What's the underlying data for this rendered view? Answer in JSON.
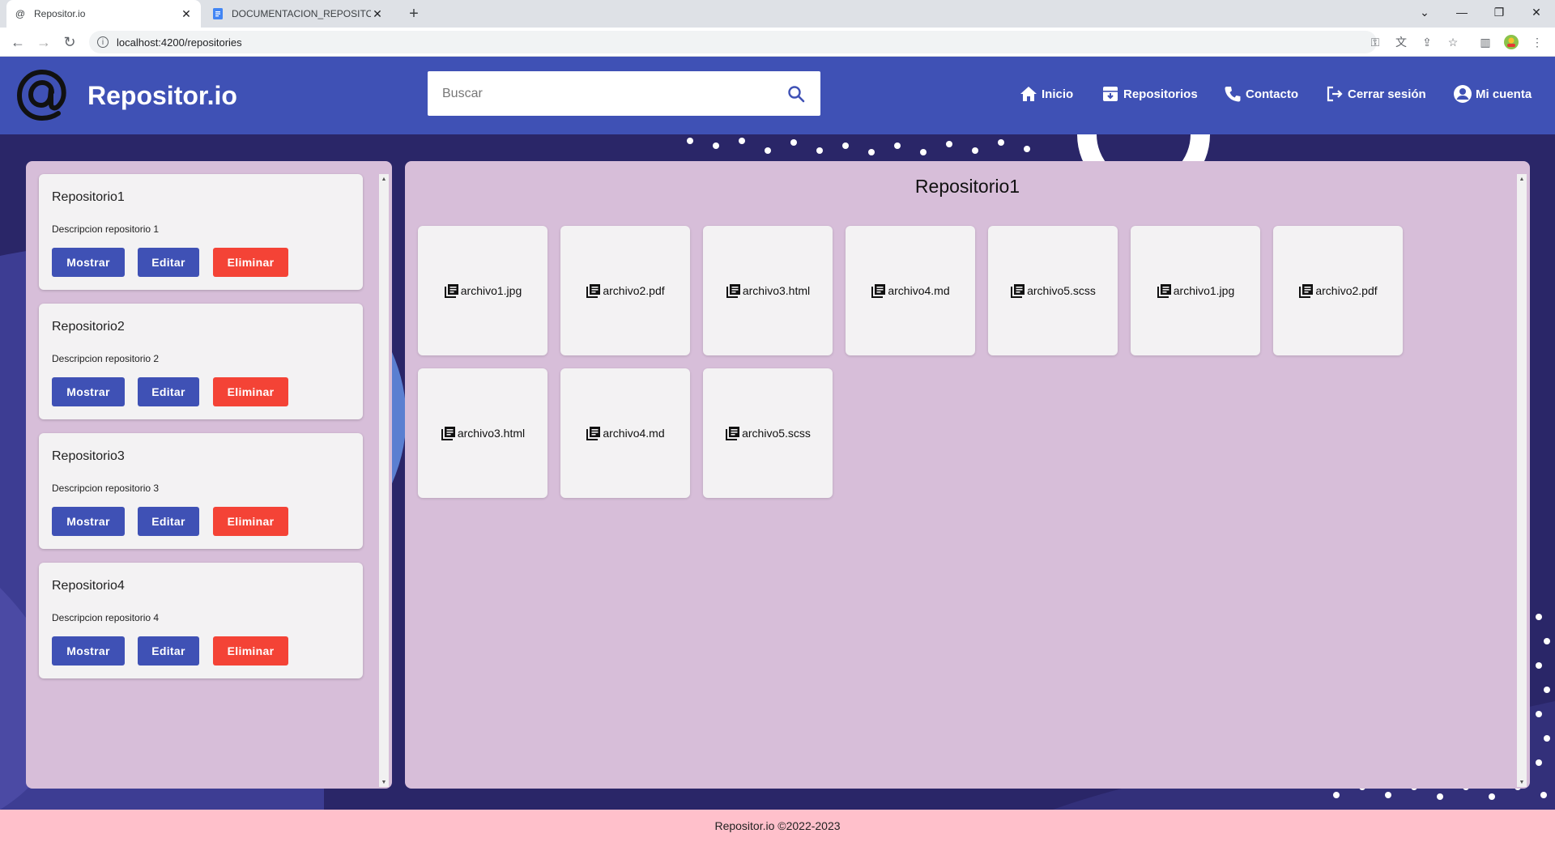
{
  "browser": {
    "tabs": [
      {
        "title": "Repositor.io",
        "active": true
      },
      {
        "title": "DOCUMENTACION_REPOSITOR.I",
        "active": false
      }
    ],
    "url": "localhost:4200/repositories"
  },
  "header": {
    "brand": "Repositor.io",
    "search_placeholder": "Buscar",
    "nav": [
      {
        "label": "Inicio",
        "icon": "home-icon"
      },
      {
        "label": "Repositorios",
        "icon": "repository-icon"
      },
      {
        "label": "Contacto",
        "icon": "phone-icon"
      },
      {
        "label": "Cerrar sesión",
        "icon": "logout-icon"
      },
      {
        "label": "Mi cuenta",
        "icon": "account-icon"
      }
    ]
  },
  "repositories": [
    {
      "name": "Repositorio1",
      "description": "Descripcion repositorio 1"
    },
    {
      "name": "Repositorio2",
      "description": "Descripcion repositorio 2"
    },
    {
      "name": "Repositorio3",
      "description": "Descripcion repositorio 3"
    },
    {
      "name": "Repositorio4",
      "description": "Descripcion repositorio 4"
    }
  ],
  "buttons": {
    "show": "Mostrar",
    "edit": "Editar",
    "delete": "Eliminar"
  },
  "selected_repository": {
    "title": "Repositorio1",
    "files": [
      "archivo1.jpg",
      "archivo2.pdf",
      "archivo3.html",
      "archivo4.md",
      "archivo5.scss",
      "archivo1.jpg",
      "archivo2.pdf",
      "archivo3.html",
      "archivo4.md",
      "archivo5.scss"
    ]
  },
  "footer": {
    "text": "Repositor.io ©2022-2023"
  },
  "colors": {
    "primary": "#3f51b5",
    "danger": "#f44336",
    "panel": "#d7bed9",
    "footer": "#ffc0cb"
  }
}
